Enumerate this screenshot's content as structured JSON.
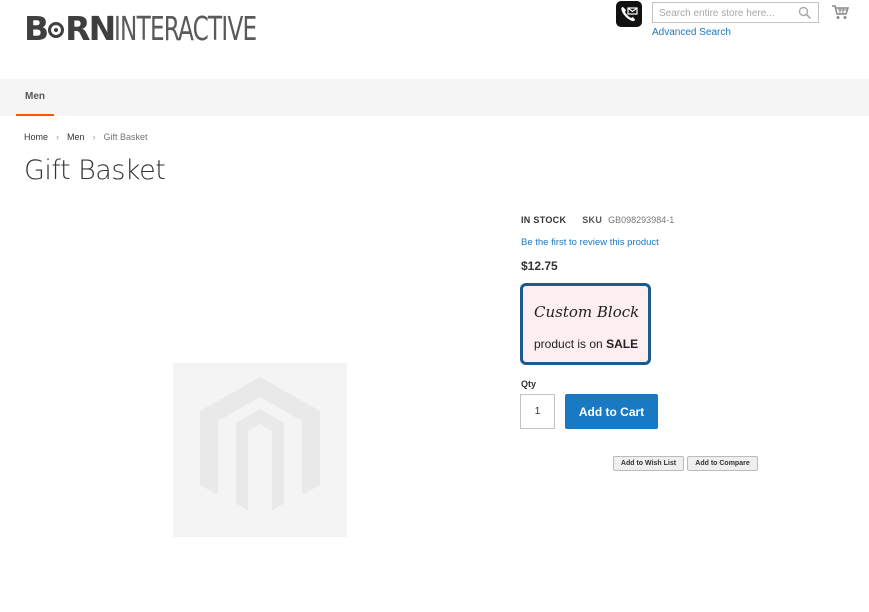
{
  "header": {
    "logo": {
      "part1": "B",
      "part2": "RN",
      "part3": "INTERACTIVE"
    },
    "search": {
      "placeholder": "Search entire store here..."
    },
    "advanced_search": "Advanced Search",
    "icons": {
      "phone": "phone-envelope-icon",
      "search": "search-icon",
      "cart": "cart-icon"
    }
  },
  "nav": {
    "items": [
      {
        "label": "Men",
        "active": true
      }
    ],
    "active_color": "#ff5501"
  },
  "breadcrumb": {
    "items": [
      "Home",
      "Men",
      "Gift Basket"
    ]
  },
  "product": {
    "title": "Gift Basket",
    "stock": "IN STOCK",
    "sku_label": "SKU",
    "sku": "GB098293984-1",
    "review_link": "Be the first to review this product",
    "price": "$12.75",
    "image_placeholder": "magento-logo-icon"
  },
  "custom_block": {
    "title": "Custom Block",
    "text_prefix": "product is on",
    "text_bold": "SALE",
    "background": "#fdeef2",
    "border_color": "#1a5a8f"
  },
  "purchase": {
    "qty_label": "Qty",
    "qty_value": "1",
    "add_to_cart": "Add to Cart",
    "wish_list": "Add to Wish List",
    "compare": "Add to Compare",
    "accent_color": "#1979c3"
  }
}
